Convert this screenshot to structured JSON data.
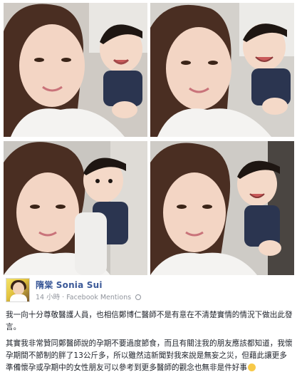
{
  "post": {
    "author": "隋棠 Sonia Sui",
    "time": "14 小時",
    "separator": "·",
    "source": "Facebook Mentions",
    "paragraph1": "我一向十分尊敬醫護人員，也相信鄭博仁醫師不是有意在不清楚實情的情況下做出此發言。",
    "paragraph2": "其實我非常贊同鄭醫師說的孕期不要過度節食，而且有關注我的朋友應該都知道，我懷孕期間不節制的胖了13公斤多，所以雖然這新聞對我來說是無妄之災，但藉此讓更多準備懷孕或孕期中的女性朋友可以參考到更多醫師的觀念也無非是件好事"
  },
  "icons": {
    "globe": "globe-icon",
    "emoji": "smile-emoji-icon"
  },
  "colors": {
    "author_link": "#3b5998",
    "meta_text": "#90949c",
    "body_text": "#1d2129"
  }
}
